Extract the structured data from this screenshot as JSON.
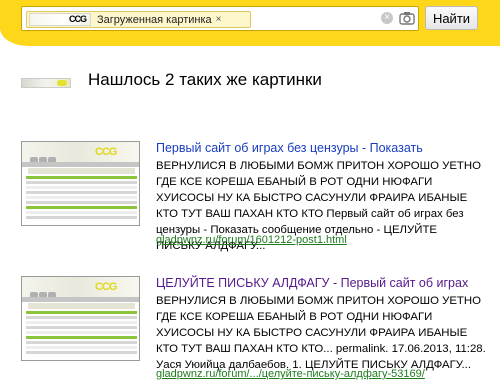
{
  "search": {
    "chip_label": "Загруженная картинка",
    "chip_close": "×",
    "chip_logo_text": "CCG",
    "clear_symbol": "×",
    "find_button": "Найти"
  },
  "summary": {
    "text": "Нашлось 2 таких же картинки"
  },
  "results": [
    {
      "title": "Первый сайт об играх без цензуры - Показать",
      "snippet": "ВЕРНУЛИСЯ В ЛЮБЫМИ БОМЖ ПРИТОН ХОРОШО УЕТНО ГДЕ КСЕ КОРЕША ЕБАНЫЙ В РОТ ОДНИ НЮФАГИ ХУИСОСЫ НУ КА БЫСТРО САСУНУЛИ ФРАИРА ИБАНЫЕ КТО ТУТ ВАШ ПАХАН КТО КТО Первый сайт об играх без цензуры - Показать сообщение отдельно - ЦЕЛУЙТЕ ПИСЬКУ АЛДФАГУ...",
      "url": "gladpwnz.ru/forum/1601212-post1.html",
      "thumb_logo": "CCG"
    },
    {
      "title": "ЦЕЛУЙТЕ ПИСЬКУ АЛДФАГУ - Первый сайт об играх",
      "snippet": "ВЕРНУЛИСЯ В ЛЮБЫМИ БОМЖ ПРИТОН ХОРОШО УЕТНО ГДЕ КСЕ КОРЕША ЕБАНЫЙ В РОТ ОДНИ НЮФАГИ ХУИСОСЫ НУ КА БЫСТРО САСУНУЛИ ФРАИРА ИБАНЫЕ КТО ТУТ ВАШ ПАХАН КТО КТО... permalink. 17.06.2013, 11:28. Уася Уюийца далбаебов. 1. ЦЕЛУЙТЕ ПИСЬКУ АЛДФАГУ...",
      "url": "gladpwnz.ru/forum/.../целуйте-письку-алдфагу-53169/",
      "thumb_logo": "CCG"
    }
  ],
  "colors": {
    "topbar": "#ffd71a",
    "link": "#1a3dc1",
    "visited_link": "#551a8b",
    "url_green": "#1f7a1f"
  }
}
